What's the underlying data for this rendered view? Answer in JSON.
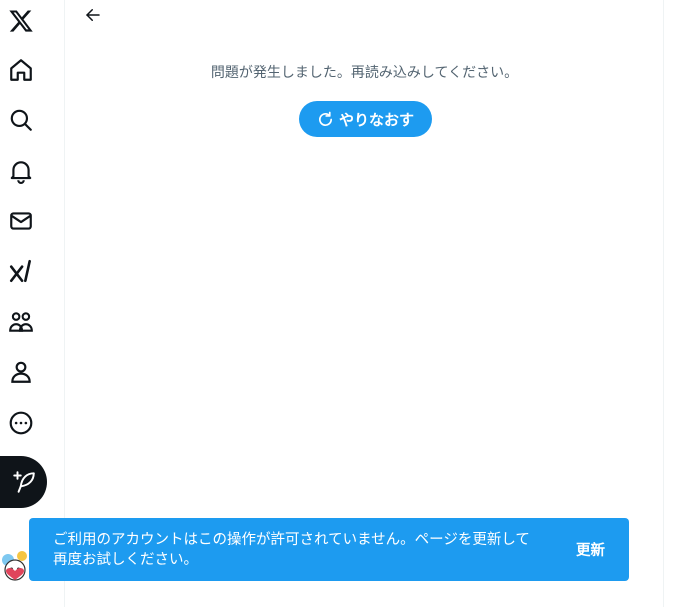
{
  "nav": {
    "items": [
      {
        "name": "x-logo-icon"
      },
      {
        "name": "home-icon"
      },
      {
        "name": "search-icon"
      },
      {
        "name": "notifications-bell-icon"
      },
      {
        "name": "messages-envelope-icon"
      },
      {
        "name": "grok-icon"
      },
      {
        "name": "communities-icon"
      },
      {
        "name": "profile-icon"
      },
      {
        "name": "more-icon"
      }
    ],
    "compose_icon": "compose-feather-icon"
  },
  "main": {
    "back_icon": "arrow-left-icon",
    "error_message": "問題が発生しました。再読み込みしてください。",
    "retry_label": "やりなおす",
    "retry_icon": "refresh-icon"
  },
  "toast": {
    "line1": "ご利用のアカウントはこの操作が許可されていません。ページを更新して",
    "line2": "再度お試しください。",
    "action_label": "更新"
  },
  "colors": {
    "accent": "#1d9bf0",
    "text_primary": "#0f1419",
    "text_secondary": "#536471",
    "border": "#eff3f4"
  }
}
